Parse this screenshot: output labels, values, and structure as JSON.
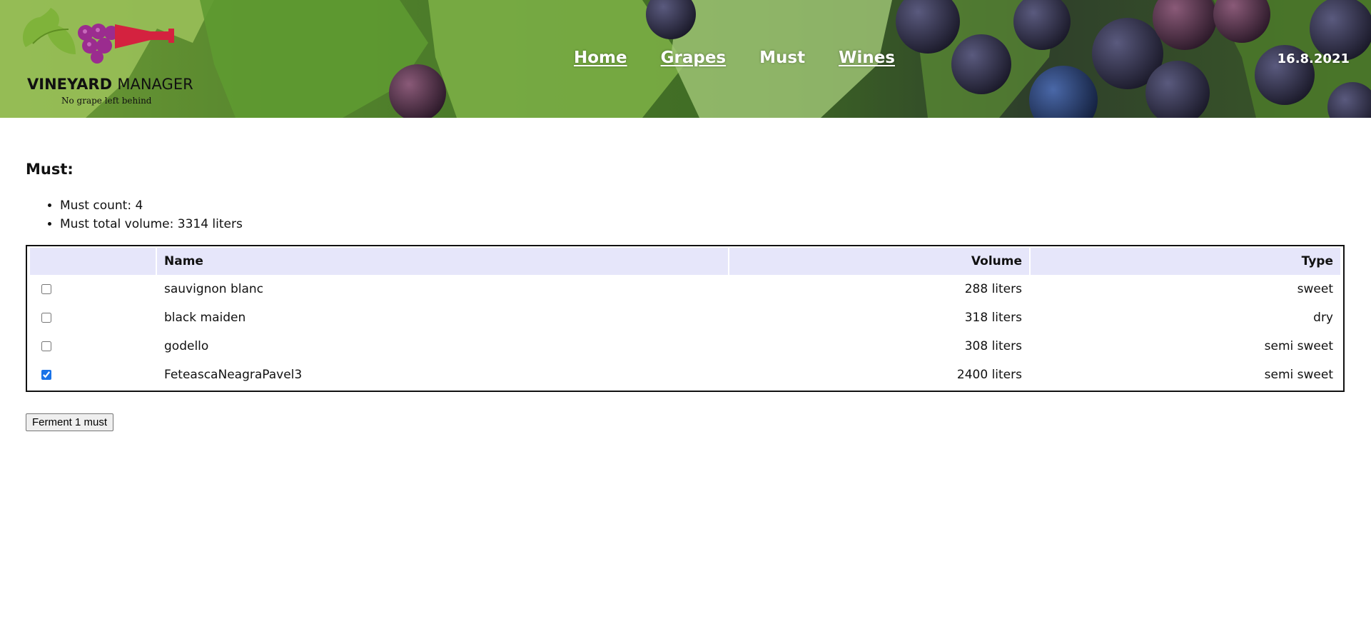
{
  "header": {
    "logo": {
      "title_bold": "VINEYARD",
      "title_thin": "MANAGER",
      "tagline": "No grape left behind"
    },
    "nav": [
      {
        "label": "Home",
        "active": false
      },
      {
        "label": "Grapes",
        "active": false
      },
      {
        "label": "Must",
        "active": true
      },
      {
        "label": "Wines",
        "active": false
      }
    ],
    "date": "16.8.2021"
  },
  "main": {
    "heading": "Must:",
    "stats": {
      "count": "Must count: 4",
      "total_volume": "Must total volume: 3314 liters"
    },
    "table": {
      "columns": [
        "",
        "Name",
        "Volume",
        "Type"
      ],
      "rows": [
        {
          "checked": false,
          "name": "sauvignon blanc",
          "volume": "288 liters",
          "type": "sweet"
        },
        {
          "checked": false,
          "name": "black maiden",
          "volume": "318 liters",
          "type": "dry"
        },
        {
          "checked": false,
          "name": "godello",
          "volume": "308 liters",
          "type": "semi sweet"
        },
        {
          "checked": true,
          "name": "FeteascaNeagraPavel3",
          "volume": "2400 liters",
          "type": "semi sweet"
        }
      ]
    },
    "ferment_button_label": "Ferment 1 must"
  },
  "colors": {
    "table_header_bg": "#e6e6fa",
    "logo_wine_red": "#d4223f",
    "logo_grape_purple": "#9b2c8f",
    "logo_leaf_green": "#7fb33a"
  },
  "icons": [
    "logo-grapes-icon",
    "logo-bottle-icon",
    "logo-leaf-icon"
  ]
}
